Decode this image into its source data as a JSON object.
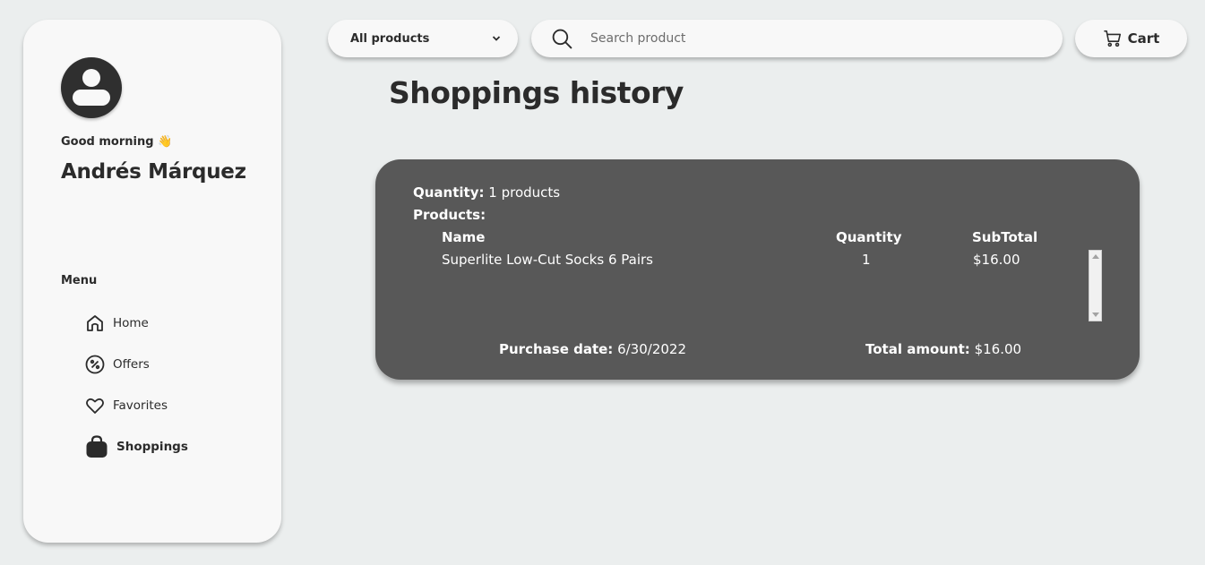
{
  "sidebar": {
    "greeting": "Good morning",
    "greeting_emoji": "👋",
    "user_name": "Andrés Márquez",
    "menu_title": "Menu",
    "items": [
      {
        "label": "Home",
        "icon": "home-icon"
      },
      {
        "label": "Offers",
        "icon": "percent-badge-icon"
      },
      {
        "label": "Favorites",
        "icon": "heart-icon"
      },
      {
        "label": "Shoppings",
        "icon": "shopping-bag-icon",
        "active": true
      }
    ]
  },
  "topbar": {
    "category_selected": "All products",
    "search_placeholder": "Search product",
    "cart_label": "Cart"
  },
  "page": {
    "title": "Shoppings history"
  },
  "order": {
    "quantity_label": "Quantity:",
    "quantity_value": "1 products",
    "products_label": "Products:",
    "columns": {
      "name": "Name",
      "quantity": "Quantity",
      "subtotal": "SubTotal"
    },
    "rows": [
      {
        "name": "Superlite Low-Cut Socks 6 Pairs",
        "quantity": "1",
        "subtotal": "$16.00"
      }
    ],
    "purchase_date_label": "Purchase date:",
    "purchase_date_value": "6/30/2022",
    "total_label": "Total amount:",
    "total_value": "$16.00"
  },
  "colors": {
    "background": "#ebeeee",
    "panel": "#f8f8f8",
    "card": "#585858",
    "text": "#2b2b2b"
  }
}
